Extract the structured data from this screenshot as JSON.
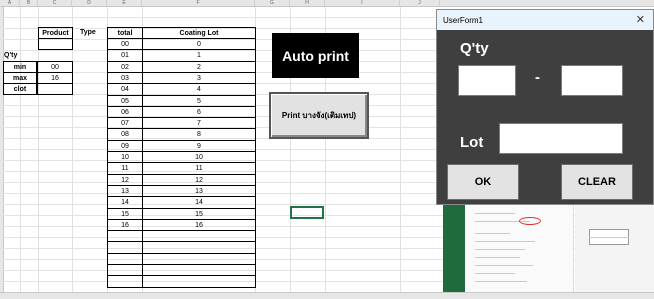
{
  "sheet": {
    "column_headers": [
      "A",
      "B",
      "C",
      "D",
      "E",
      "F",
      "G",
      "H",
      "I",
      "J"
    ],
    "table_headers": {
      "product": "Product",
      "type": "Type",
      "total": "total",
      "coating_lot": "Coating Lot"
    },
    "qty_label": "Q'ty",
    "side_labels": [
      {
        "label": "min",
        "value": "00"
      },
      {
        "label": "max",
        "value": "16"
      },
      {
        "label": "clot",
        "value": ""
      }
    ],
    "rows": [
      {
        "total": "00",
        "lot": "0"
      },
      {
        "total": "01",
        "lot": "1"
      },
      {
        "total": "02",
        "lot": "2"
      },
      {
        "total": "03",
        "lot": "3"
      },
      {
        "total": "04",
        "lot": "4"
      },
      {
        "total": "05",
        "lot": "5"
      },
      {
        "total": "06",
        "lot": "6"
      },
      {
        "total": "07",
        "lot": "7"
      },
      {
        "total": "08",
        "lot": "8"
      },
      {
        "total": "09",
        "lot": "9"
      },
      {
        "total": "10",
        "lot": "10"
      },
      {
        "total": "11",
        "lot": "11"
      },
      {
        "total": "12",
        "lot": "12"
      },
      {
        "total": "13",
        "lot": "13"
      },
      {
        "total": "14",
        "lot": "14"
      },
      {
        "total": "15",
        "lot": "15"
      },
      {
        "total": "16",
        "lot": "16"
      }
    ],
    "auto_print_label": "Auto print",
    "print_button_label": "Print บางจัง(เติมเทป)"
  },
  "userform": {
    "title": "UserForm1",
    "close_glyph": "✕",
    "qty_label": "Q'ty",
    "dash": "-",
    "lot_label": "Lot",
    "qty_from_value": "",
    "qty_to_value": "",
    "lot_value": "",
    "ok_label": "OK",
    "clear_label": "CLEAR"
  },
  "colors": {
    "form_bg": "#3f3f3f",
    "title_bar": "#e8f3fb",
    "excel_green": "#217346"
  }
}
